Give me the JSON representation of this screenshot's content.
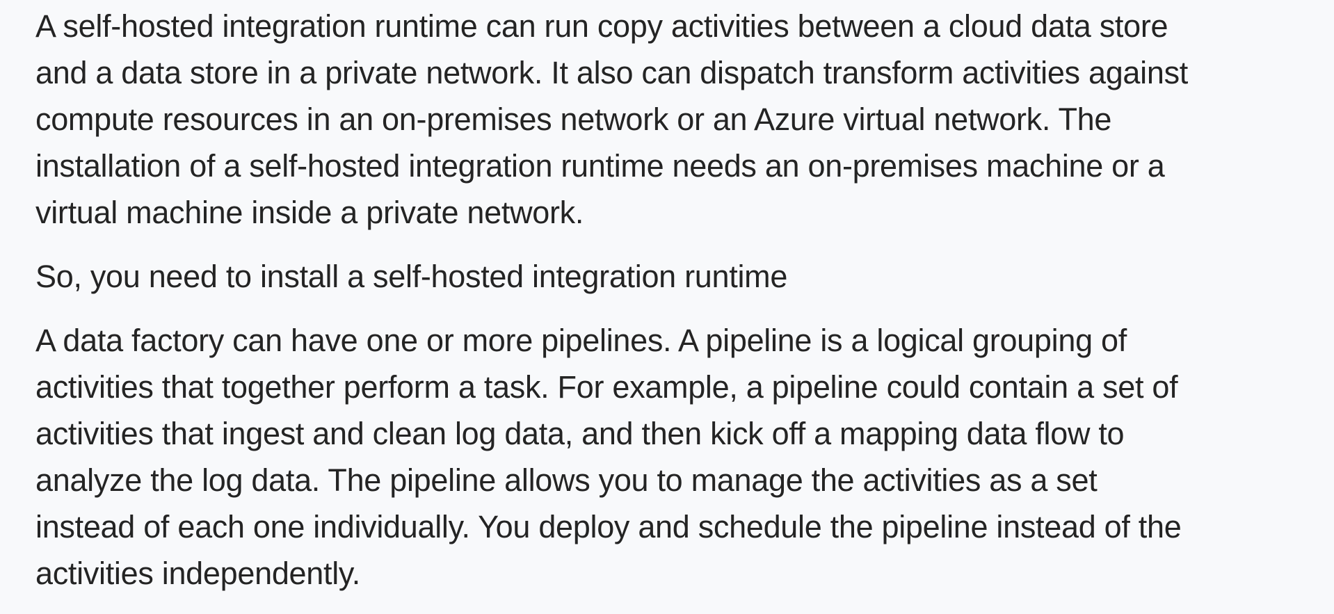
{
  "paragraphs": [
    {
      "lines": [
        "A self-hosted integration runtime can run copy activities between a cloud data store",
        "and a data store in a private network. It also can dispatch transform activities against",
        "compute resources in an on-premises network or an Azure virtual network. The",
        "installation of a self-hosted integration runtime needs an on-premises machine or a",
        "virtual machine inside a private network."
      ]
    },
    {
      "lines": [
        "So, you need to install a self-hosted integration runtime"
      ]
    },
    {
      "lines": [
        "A data factory can have one or more pipelines. A pipeline is a logical grouping of",
        "activities that together perform a task. For example, a pipeline could contain a set of",
        "activities that ingest and clean log data, and then kick off a mapping data flow to",
        "analyze the log data. The pipeline allows you to manage the activities as a set",
        "instead of each one individually. You deploy and schedule the pipeline instead of the",
        "activities independently."
      ]
    }
  ]
}
